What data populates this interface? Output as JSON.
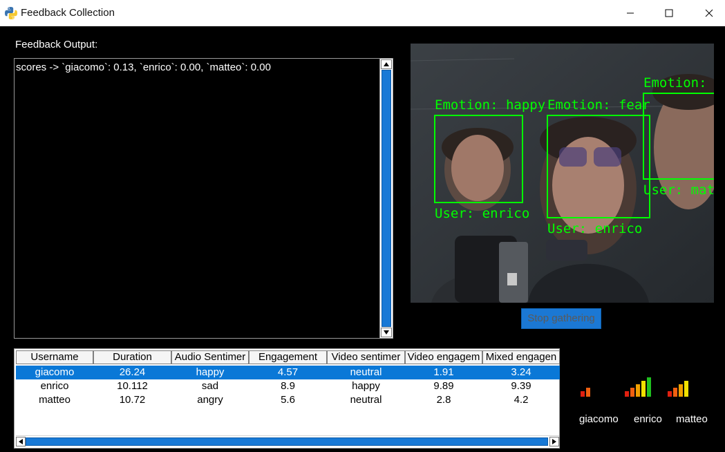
{
  "window": {
    "title": "Feedback Collection",
    "icon": "python-icon"
  },
  "feedback": {
    "label": "Feedback Output:",
    "text": "scores -> `giacomo`: 0.13, `enrico`: 0.00, `matteo`: 0.00"
  },
  "video": {
    "overlays": [
      {
        "label": "Emotion: happy"
      },
      {
        "label": "User: enrico"
      },
      {
        "label": "Emotion: fear"
      },
      {
        "label": "User: enrico"
      },
      {
        "label": "Emotion: e"
      },
      {
        "label": "User: matt"
      }
    ],
    "overlay_color": "#00ff00"
  },
  "controls": {
    "stop_label": "Stop gathering"
  },
  "table": {
    "columns": [
      "Username",
      "Duration",
      "Audio Sentimer",
      "Engagement",
      "Video sentimer",
      "Video engagem",
      "Mixed engagen"
    ],
    "rows": [
      [
        "giacomo",
        "26.24",
        "happy",
        "4.57",
        "neutral",
        "1.91",
        "3.24"
      ],
      [
        "enrico",
        "10.112",
        "sad",
        "8.9",
        "happy",
        "9.89",
        "9.39"
      ],
      [
        "matteo",
        "10.72",
        "angry",
        "5.6",
        "neutral",
        "2.8",
        "4.2"
      ]
    ],
    "selected_row": 0,
    "selection_color": "#0a78d7"
  },
  "meters": [
    {
      "name": "giacomo",
      "level": 2,
      "max": 5
    },
    {
      "name": "enrico",
      "level": 5,
      "max": 5
    },
    {
      "name": "matteo",
      "level": 4,
      "max": 5
    }
  ],
  "meter_colors": [
    "#e02010",
    "#f06010",
    "#f0a000",
    "#f0e000",
    "#20c020"
  ]
}
